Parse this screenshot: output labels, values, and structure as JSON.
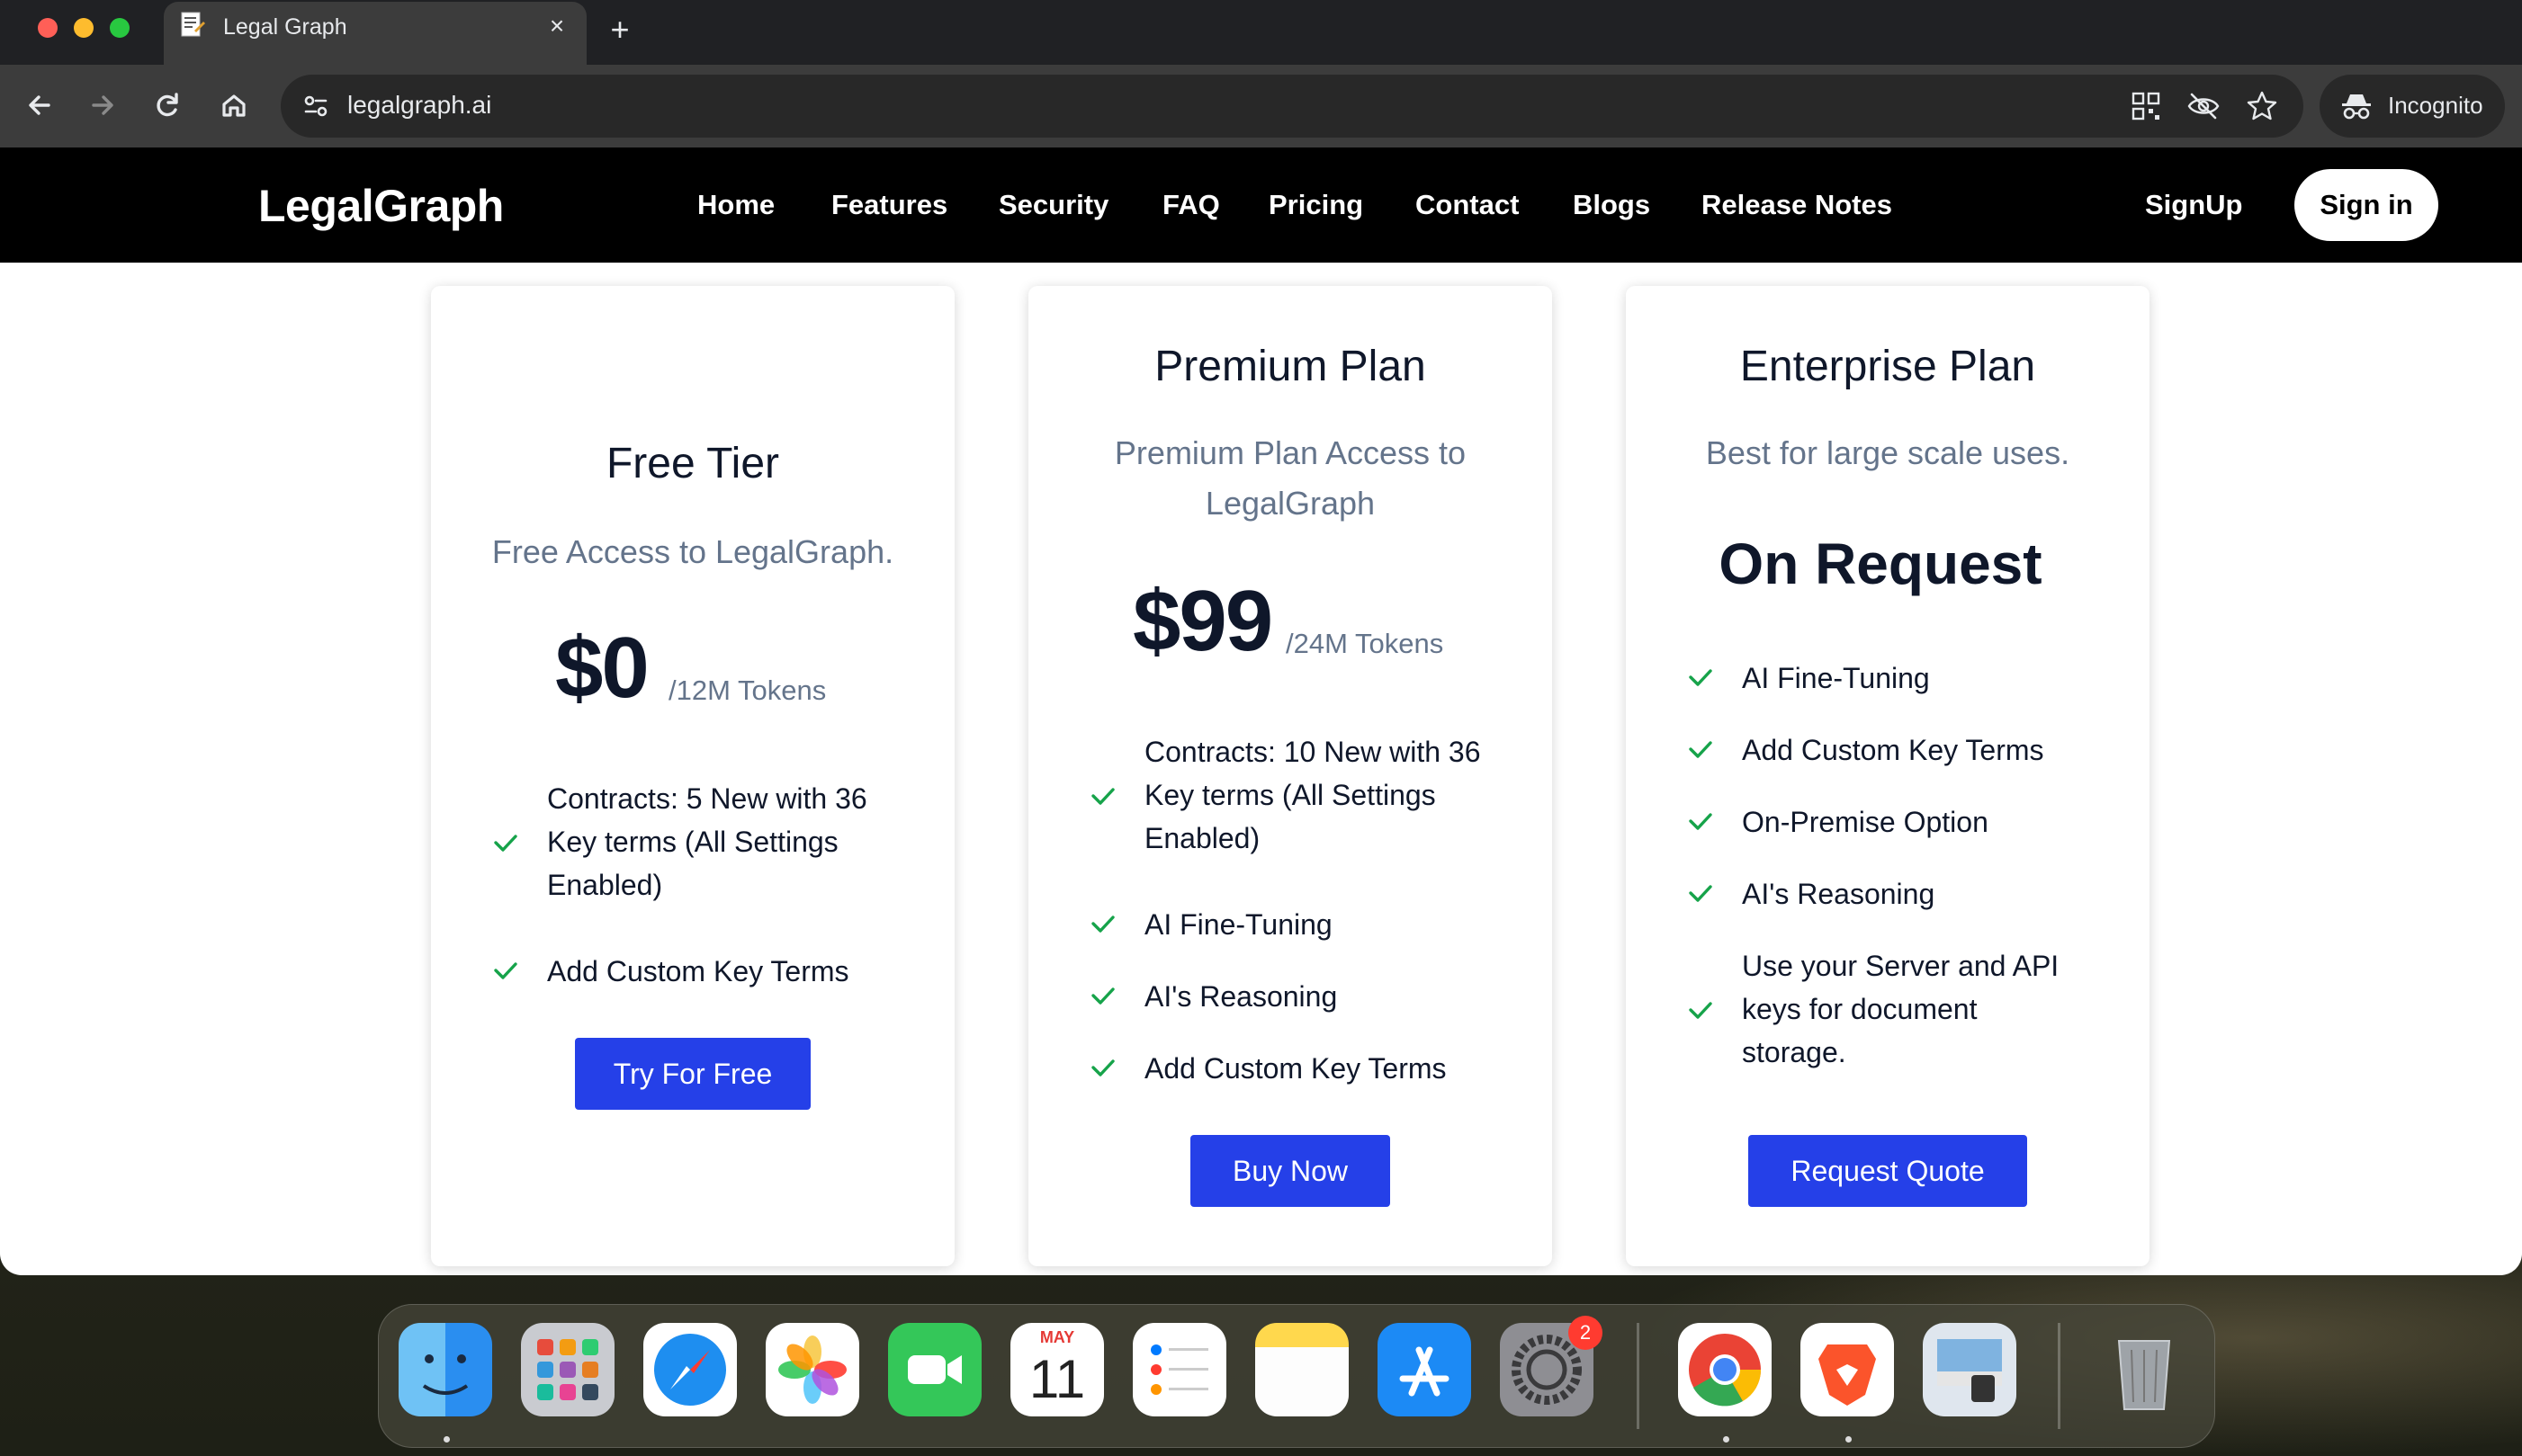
{
  "browser": {
    "tab_title": "Legal Graph",
    "new_tab_symbol": "+",
    "close_symbol": "×",
    "url": "legalgraph.ai",
    "incognito_label": "Incognito",
    "traffic_light_colors": [
      "#ff5f57",
      "#febc2e",
      "#28c840"
    ]
  },
  "site": {
    "logo": "LegalGraph",
    "nav": [
      "Home",
      "Features",
      "Security",
      "FAQ",
      "Pricing",
      "Contact",
      "Blogs",
      "Release Notes"
    ],
    "signup_label": "SignUp",
    "signin_label": "Sign in"
  },
  "plans": [
    {
      "title": "Free Tier",
      "subtitle": "Free Access to LegalGraph.",
      "price": "$0",
      "unit": "/12M Tokens",
      "features": [
        "Contracts: 5 New with 36 Key terms (All Settings Enabled)",
        "Add Custom Key Terms"
      ],
      "button": "Try For Free"
    },
    {
      "title": "Premium Plan",
      "subtitle": "Premium Plan Access to LegalGraph",
      "price": "$99",
      "unit": "/24M Tokens",
      "features": [
        "Contracts: 10 New with 36 Key terms (All Settings Enabled)",
        "AI Fine-Tuning",
        "AI's Reasoning",
        "Add Custom Key Terms"
      ],
      "button": "Buy Now"
    },
    {
      "title": "Enterprise Plan",
      "subtitle": "Best for large scale uses.",
      "price": "On Request",
      "features": [
        "AI Fine-Tuning",
        "Add Custom Key Terms",
        "On-Premise Option",
        "AI's Reasoning",
        "Use your Server and API keys for document storage."
      ],
      "button": "Request Quote"
    }
  ],
  "dock": {
    "apps": [
      "Finder",
      "Launchpad",
      "Safari",
      "Photos",
      "FaceTime",
      "Calendar",
      "Reminders",
      "Notes",
      "App Store",
      "System Settings",
      "Google Chrome",
      "Brave Browser",
      "Preview",
      "Trash"
    ],
    "calendar_month": "MAY",
    "calendar_day": "11",
    "settings_badge": "2"
  },
  "colors": {
    "accent_button": "#2540e8",
    "check_green": "#16a34a",
    "nav_bg": "#000000"
  }
}
